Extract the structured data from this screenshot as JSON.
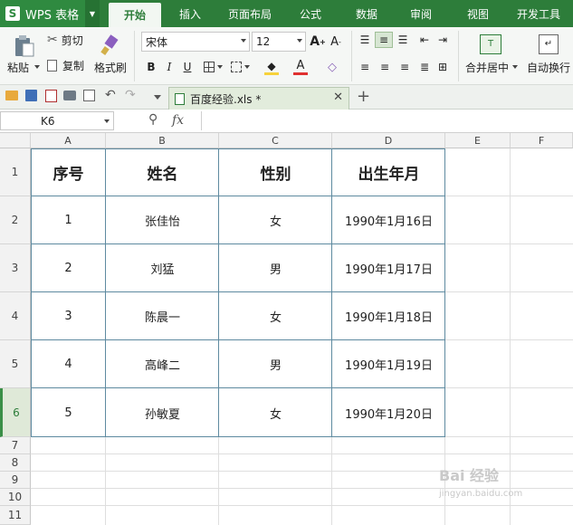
{
  "app": {
    "logo_letter": "S",
    "name": "WPS 表格"
  },
  "tabs": [
    "开始",
    "插入",
    "页面布局",
    "公式",
    "数据",
    "审阅",
    "视图",
    "开发工具"
  ],
  "active_tab_index": 0,
  "ribbon": {
    "cut": "剪切",
    "paste": "粘贴",
    "copy": "复制",
    "format_painter": "格式刷",
    "font_name": "宋体",
    "font_size": "12",
    "bold": "B",
    "italic": "I",
    "underline": "U",
    "merge_center": "合并居中",
    "wrap_text": "自动换行",
    "font_color": "#e03030",
    "fill_color": "#f7d23b",
    "accent": "#2d7d3a"
  },
  "document_tab": {
    "name": "百度经验.xls *"
  },
  "formula_bar": {
    "cell_ref": "K6",
    "fx": "fx"
  },
  "columns": [
    "A",
    "B",
    "C",
    "D",
    "E",
    "F"
  ],
  "rows": [
    "1",
    "2",
    "3",
    "4",
    "5",
    "6",
    "7",
    "8",
    "9",
    "10",
    "11"
  ],
  "selected_row": "6",
  "table": {
    "headers": [
      "序号",
      "姓名",
      "性别",
      "出生年月"
    ],
    "rows": [
      [
        "1",
        "张佳怡",
        "女",
        "1990年1月16日"
      ],
      [
        "2",
        "刘猛",
        "男",
        "1990年1月17日"
      ],
      [
        "3",
        "陈晨一",
        "女",
        "1990年1月18日"
      ],
      [
        "4",
        "高峰二",
        "男",
        "1990年1月19日"
      ],
      [
        "5",
        "孙敏夏",
        "女",
        "1990年1月20日"
      ]
    ]
  },
  "watermark": {
    "line1": "Bai 经验",
    "line2": "jingyan.baidu.com"
  }
}
